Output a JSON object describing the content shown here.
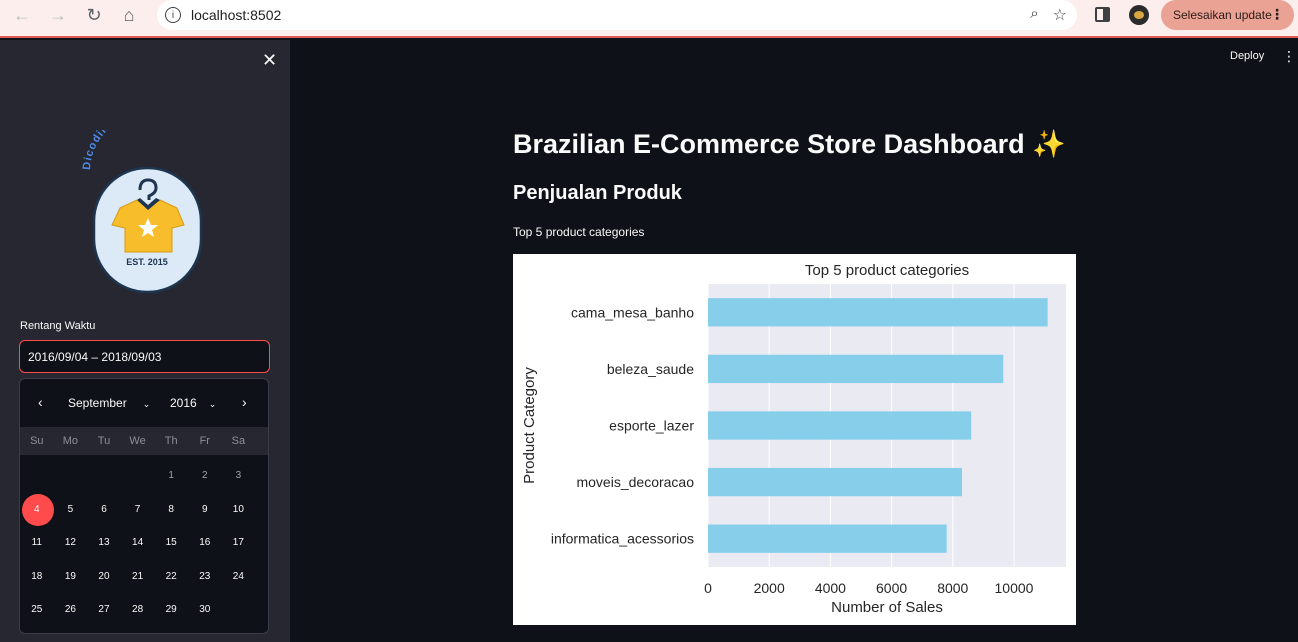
{
  "browser": {
    "url": "localhost:8502",
    "update_label": "Selesaikan update"
  },
  "sidebar": {
    "logo_text_top": "Dicoding Collection",
    "logo_est": "EST. 2015",
    "date_label": "Rentang Waktu",
    "date_value": "2016/09/04 – 2018/09/03",
    "calendar": {
      "month": "September",
      "year": "2016",
      "weekdays": [
        "Su",
        "Mo",
        "Tu",
        "We",
        "Th",
        "Fr",
        "Sa"
      ],
      "weeks": [
        [
          "",
          "",
          "",
          "",
          "1",
          "2",
          "3"
        ],
        [
          "4",
          "5",
          "6",
          "7",
          "8",
          "9",
          "10"
        ],
        [
          "11",
          "12",
          "13",
          "14",
          "15",
          "16",
          "17"
        ],
        [
          "18",
          "19",
          "20",
          "21",
          "22",
          "23",
          "24"
        ],
        [
          "25",
          "26",
          "27",
          "28",
          "29",
          "30",
          ""
        ]
      ],
      "selected_day": "4"
    }
  },
  "header": {
    "deploy_label": "Deploy"
  },
  "main": {
    "title": "Brazilian E-Commerce Store Dashboard ✨",
    "subtitle": "Penjualan Produk",
    "caption": "Top 5 product categories"
  },
  "chart_data": {
    "type": "bar",
    "orientation": "horizontal",
    "title": "Top 5 product categories",
    "xlabel": "Number of Sales",
    "ylabel": "Product Category",
    "categories": [
      "cama_mesa_banho",
      "beleza_saude",
      "esporte_lazer",
      "moveis_decoracao",
      "informatica_acessorios"
    ],
    "values": [
      11100,
      9650,
      8600,
      8300,
      7800
    ],
    "xlim": [
      0,
      11700
    ],
    "xticks": [
      "0",
      "2000",
      "4000",
      "6000",
      "8000",
      "10000"
    ],
    "bar_color": "#87ceeb",
    "plot_bg": "#eaeaf2"
  }
}
